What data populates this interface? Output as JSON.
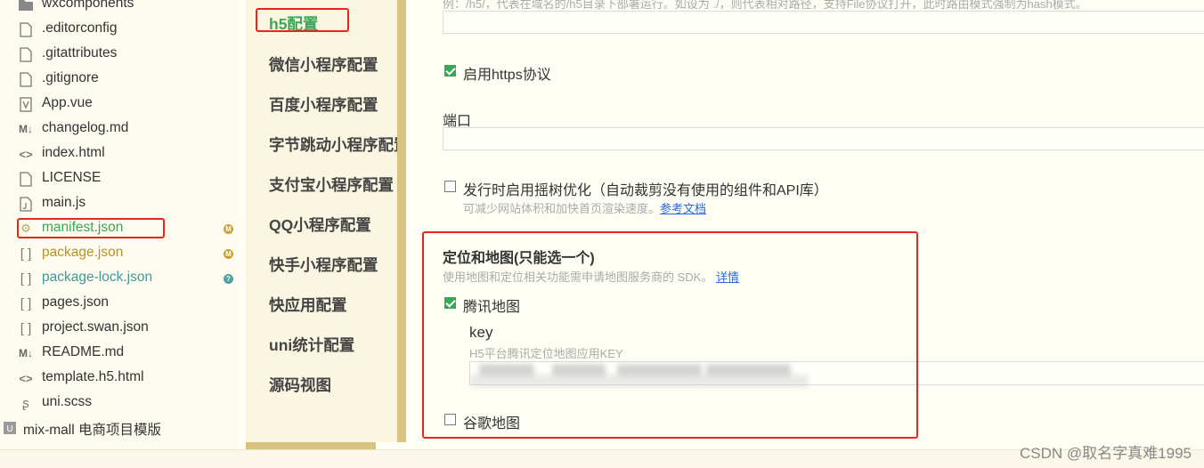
{
  "file_tree": {
    "items": [
      {
        "label": "wxcomponents",
        "icon": "folder-icon"
      },
      {
        "label": ".editorconfig",
        "icon": "file-icon"
      },
      {
        "label": ".gitattributes",
        "icon": "file-icon"
      },
      {
        "label": ".gitignore",
        "icon": "file-icon"
      },
      {
        "label": "App.vue",
        "icon": "vue-file-icon"
      },
      {
        "label": "changelog.md",
        "icon": "markdown-file-icon"
      },
      {
        "label": "index.html",
        "icon": "html-file-icon"
      },
      {
        "label": "LICENSE",
        "icon": "file-icon"
      },
      {
        "label": "main.js",
        "icon": "js-file-icon"
      },
      {
        "label": "manifest.json",
        "icon": "gear-file-icon",
        "badge": "M"
      },
      {
        "label": "package.json",
        "icon": "json-file-icon",
        "badge": "M"
      },
      {
        "label": "package-lock.json",
        "icon": "json-file-icon",
        "badge": "?"
      },
      {
        "label": "pages.json",
        "icon": "json-file-icon"
      },
      {
        "label": "project.swan.json",
        "icon": "json-file-icon"
      },
      {
        "label": "README.md",
        "icon": "markdown-file-icon"
      },
      {
        "label": "template.h5.html",
        "icon": "html-file-icon"
      },
      {
        "label": "uni.scss",
        "icon": "scss-file-icon"
      }
    ],
    "project": {
      "label": "mix-mall 电商项目模版",
      "icon": "project-icon"
    }
  },
  "section_nav": {
    "items": [
      "h5配置",
      "微信小程序配置",
      "百度小程序配置",
      "字节跳动小程序配置",
      "支付宝小程序配置",
      "QQ小程序配置",
      "快手小程序配置",
      "快应用配置",
      "uni统计配置",
      "源码视图"
    ]
  },
  "settings": {
    "top_hint": "例：/h5/，代表在域名的/h5目录下部署运行。如设为 ./，则代表相对路径，支持File协议打开，此时路由模式强制为hash模式。",
    "https": {
      "label": "启用https协议",
      "checked": true
    },
    "port": {
      "label": "端口",
      "value": ""
    },
    "treeshake": {
      "label": "发行时启用摇树优化（自动裁剪没有使用的组件和API库）",
      "hint": "可减少网站体积和加快首页渲染速度。",
      "link": "参考文档",
      "checked": false
    },
    "map": {
      "title": "定位和地图(只能选一个)",
      "hint": "使用地图和定位相关功能需申请地图服务商的 SDK。",
      "link": "详情",
      "tencent": {
        "label": "腾讯地图",
        "checked": true
      },
      "key": {
        "label": "key",
        "hint": "H5平台腾讯定位地图应用KEY"
      },
      "google": {
        "label": "谷歌地图",
        "checked": false
      }
    }
  },
  "watermark": "CSDN @取名字真难1995",
  "colors": {
    "highlight": "#e8261f",
    "modified": "#c9a230",
    "untracked": "#4da3a0",
    "check": "#3aa757",
    "link": "#2b6ad8"
  }
}
